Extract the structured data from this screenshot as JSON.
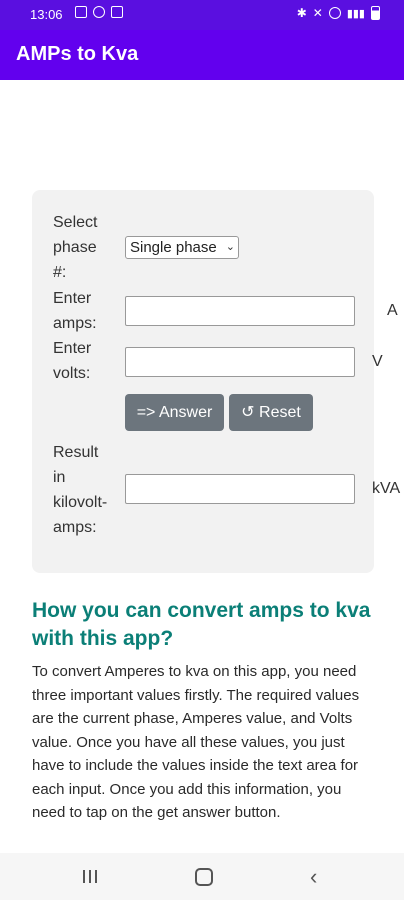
{
  "status": {
    "time": "13:06"
  },
  "app": {
    "title": "AMPs to Kva"
  },
  "form": {
    "phase_label": "Select\nphase\n#:",
    "phase_value": "Single phase",
    "amps_label": "Enter\namps:",
    "amps_unit": "A",
    "volts_label": "Enter\nvolts:",
    "volts_unit": "V",
    "answer_button": "=> Answer",
    "reset_button": "↺ Reset",
    "result_label": "Result\nin\nkilovolt-\namps:",
    "result_unit": "kVA",
    "amps_value": "",
    "volts_value": "",
    "result_value": ""
  },
  "article": {
    "heading": "How you can convert amps to kva with this app?",
    "paragraph": "To convert Amperes to kva on this app, you need three important values firstly. The required values are the current phase, Amperes value, and Volts value. Once you have all these values, you just have to include the values inside the text area for each input. Once you add this information, you need to tap on the get answer button."
  },
  "colors": {
    "status_bar": "#5a0fe0",
    "app_bar": "#6200ee",
    "heading": "#0b7f77",
    "button": "#6c757d"
  }
}
